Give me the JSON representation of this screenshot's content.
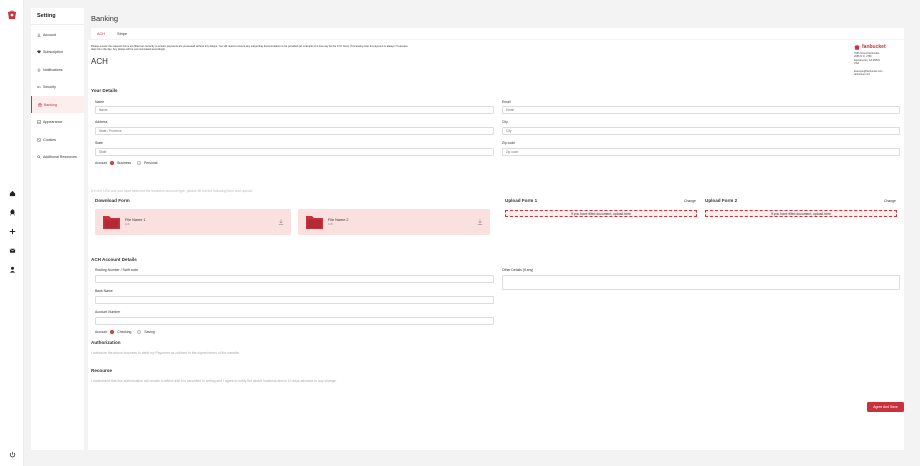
{
  "rail": {
    "items": [
      "home-icon",
      "rocket-icon",
      "plus-icon",
      "inbox-icon",
      "user-icon"
    ],
    "bottom": "power-icon"
  },
  "sidebar": {
    "title": "Setting",
    "items": [
      {
        "label": "Account",
        "icon": "download-icon"
      },
      {
        "label": "Subscription",
        "icon": "heart-icon"
      },
      {
        "label": "Notifications",
        "icon": "bell-icon"
      },
      {
        "label": "Security",
        "icon": "key-icon"
      },
      {
        "label": "Banking",
        "icon": "bank-icon"
      },
      {
        "label": "Appearance",
        "icon": "image-icon"
      },
      {
        "label": "Cookies",
        "icon": "cookie-icon"
      },
      {
        "label": "Additional Resources",
        "icon": "search-icon"
      }
    ]
  },
  "page": {
    "title": "Banking",
    "tabs": [
      "ACH",
      "Stripe"
    ],
    "notice": "Please ensure the relevant forms are filled out correctly to ensure payments are processed without any delays. You will need to ensure any supporting documentation to be provided (an example of a few may be the KYC form). Processing time for payment is always 7 business days from the day. Any delays will be communicated accordingly.",
    "heading": "ACH"
  },
  "brand": {
    "name": "fanbucket",
    "address": [
      "7665 GALA Fanbucket",
      "2086 N.O. 2760",
      "Sacramento, CA 95801",
      "USA"
    ],
    "contact": [
      "Example@fanbucket.com",
      "fanbucket.com"
    ]
  },
  "your_details": {
    "title": "Your Details",
    "name_label": "Name",
    "name_placeholder": "Name",
    "email_label": "Email",
    "email_placeholder": "Email",
    "address_label": "Address",
    "address_placeholder": "State / Province",
    "city_label": "City",
    "city_placeholder": "City",
    "state_label": "State",
    "state_placeholder": "State",
    "zip_label": "Zip code",
    "zip_placeholder": "Zip code",
    "account_label": "Account",
    "account_options": [
      "Business",
      "Personal"
    ],
    "account_selected": "Business"
  },
  "forms": {
    "note": "If in the USA and you have selected the business account type, please fill out the following form and upload.",
    "download_title": "Download Form",
    "files": [
      {
        "name": "File Name 1",
        "size": "1kB"
      },
      {
        "name": "File Name 2",
        "size": "1kB"
      }
    ],
    "upload1_title": "Upload Form 1",
    "upload2_title": "Upload Form 2",
    "change_label": "Change",
    "dropzone_text": "If you have filled document, upload here"
  },
  "ach": {
    "title": "ACH Account Details",
    "routing_label": "Routing Number / Swift code",
    "bank_label": "Bank Name",
    "account_number_label": "Account Number",
    "other_label": "Other Details (If any)",
    "account_label": "Account",
    "account_options": [
      "Checking",
      "Saving"
    ],
    "account_selected": "Checking"
  },
  "authorization": {
    "title": "Authorization",
    "text": "I authorize the above business to debit my Payoneer as outlined in the signed terms of the website."
  },
  "recourse": {
    "title": "Recourse",
    "text": "I understand that this authorization will remain in effect until it is cancelled in writing and I agree to notify the above business above 10 days advance to any change."
  },
  "actions": {
    "submit_label": "Agree And Save"
  },
  "colors": {
    "accent": "#c8323d",
    "accent_light": "#fbe0e0"
  }
}
